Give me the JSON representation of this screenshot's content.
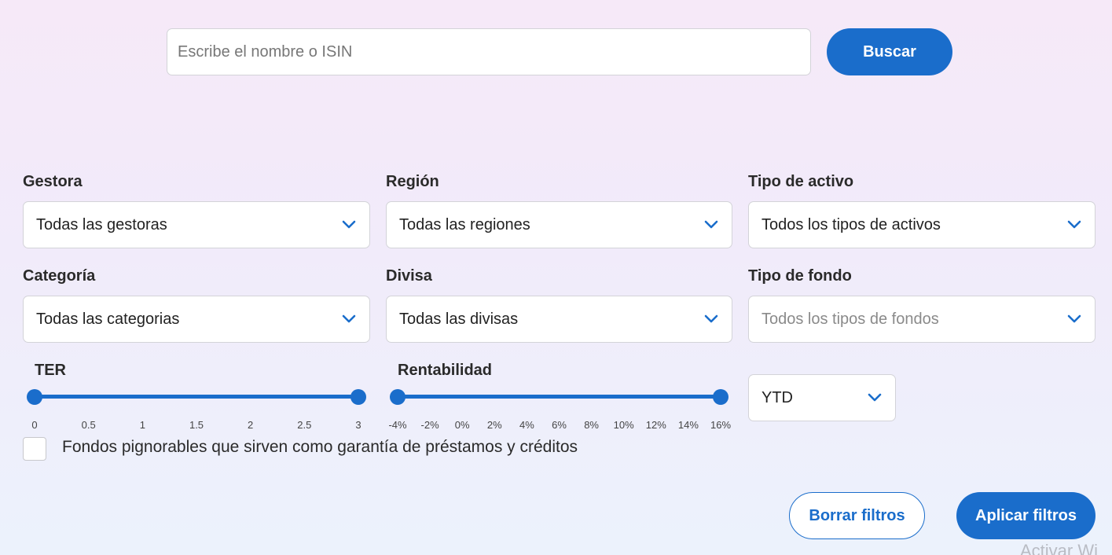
{
  "search": {
    "placeholder": "Escribe el nombre o ISIN",
    "button_label": "Buscar"
  },
  "filters": {
    "gestora": {
      "label": "Gestora",
      "value": "Todas las gestoras"
    },
    "region": {
      "label": "Región",
      "value": "Todas las regiones"
    },
    "tipo_activo": {
      "label": "Tipo de activo",
      "value": "Todos los tipos de activos"
    },
    "categoria": {
      "label": "Categoría",
      "value": "Todas las categorias"
    },
    "divisa": {
      "label": "Divisa",
      "value": "Todas las divisas"
    },
    "tipo_fondo": {
      "label": "Tipo de fondo",
      "value": "Todos los tipos de fondos"
    }
  },
  "ter": {
    "label": "TER",
    "ticks": [
      "0",
      "0.5",
      "1",
      "1.5",
      "2",
      "2.5",
      "3"
    ],
    "range": {
      "min": 0,
      "max": 3
    }
  },
  "rentabilidad": {
    "label": "Rentabilidad",
    "ticks": [
      "-4%",
      "-2%",
      "0%",
      "2%",
      "4%",
      "6%",
      "8%",
      "10%",
      "12%",
      "14%",
      "16%"
    ],
    "range": {
      "min": -4,
      "max": 16
    },
    "period_value": "YTD"
  },
  "pignorables": {
    "label": "Fondos pignorables que sirven como garantía de préstamos y créditos",
    "checked": false
  },
  "actions": {
    "clear_label": "Borrar filtros",
    "apply_label": "Aplicar filtros"
  },
  "watermark_text": "Activar Wi",
  "colors": {
    "accent": "#1a6dcb"
  },
  "icons": {
    "dropdown": "chevron-down-icon"
  }
}
